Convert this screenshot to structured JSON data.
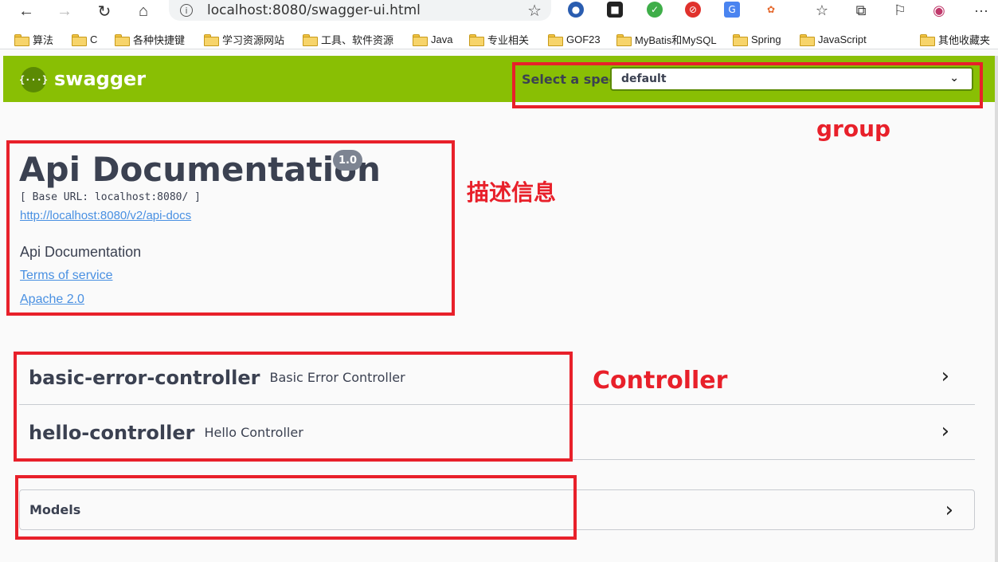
{
  "browser": {
    "url": "localhost:8080/swagger-ui.html",
    "bookmarks": [
      "算法",
      "C",
      "各种快捷键",
      "学习资源网站",
      "工具、软件资源",
      "Java",
      "专业相关",
      "GOF23",
      "MyBatis和MySQL",
      "Spring",
      "JavaScript",
      "其他收藏夹"
    ]
  },
  "header": {
    "logo_text": "swagger",
    "logo_mark": "{···}",
    "spec_label": "Select a spec",
    "spec_value": "default"
  },
  "info": {
    "title": "Api Documentation",
    "version": "1.0",
    "base_url": "[ Base URL: localhost:8080/ ]",
    "docs_link": "http://localhost:8080/v2/api-docs",
    "description": "Api Documentation",
    "terms": "Terms of service",
    "license": "Apache 2.0"
  },
  "controllers": [
    {
      "name": "basic-error-controller",
      "description": "Basic Error Controller"
    },
    {
      "name": "hello-controller",
      "description": "Hello Controller"
    }
  ],
  "models": {
    "label": "Models"
  },
  "annotations": {
    "group": "group",
    "info": "描述信息",
    "controller": "Controller"
  },
  "colors": {
    "swagger_green": "#89bf04",
    "annotation_red": "#e8202a",
    "link": "#4990e2"
  }
}
